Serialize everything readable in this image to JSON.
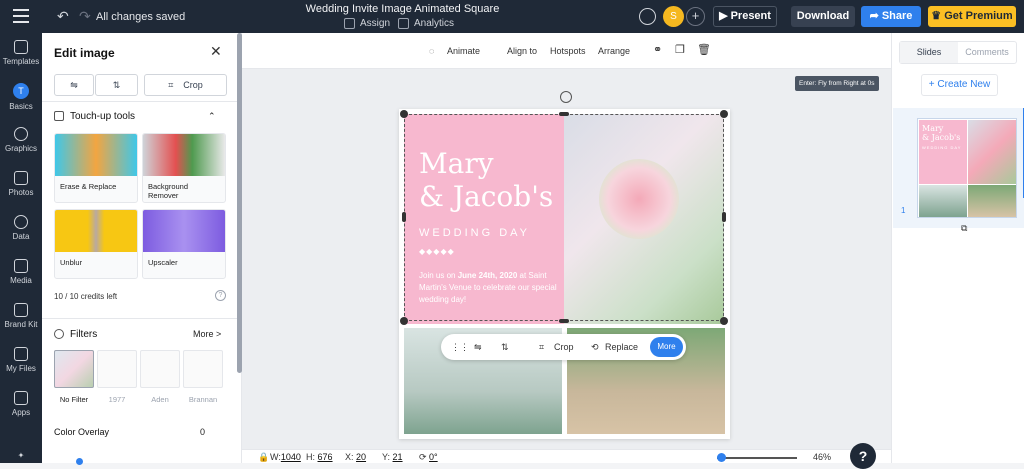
{
  "topbar": {
    "saved_status": "All changes saved",
    "doc_title": "Wedding Invite Image Animated Square",
    "assign_label": "Assign",
    "analytics_label": "Analytics",
    "avatar_initial": "S",
    "present_label": "Present",
    "download_label": "Download",
    "share_label": "Share",
    "premium_label": "Get Premium"
  },
  "rail": {
    "items": [
      {
        "label": "Templates",
        "icon": "grid-icon"
      },
      {
        "label": "Basics",
        "icon": "text-icon"
      },
      {
        "label": "Graphics",
        "icon": "shapes-icon"
      },
      {
        "label": "Photos",
        "icon": "photo-icon"
      },
      {
        "label": "Data",
        "icon": "chart-icon"
      },
      {
        "label": "Media",
        "icon": "media-icon"
      },
      {
        "label": "Brand Kit",
        "icon": "brand-icon"
      },
      {
        "label": "My Files",
        "icon": "folder-icon"
      },
      {
        "label": "Apps",
        "icon": "apps-icon"
      }
    ],
    "active_letter": "T"
  },
  "panel": {
    "title": "Edit image",
    "crop_label": "Crop",
    "touchup_title": "Touch-up tools",
    "tools": [
      {
        "label": "Erase & Replace"
      },
      {
        "label": "Background Remover"
      },
      {
        "label": "Unblur"
      },
      {
        "label": "Upscaler"
      }
    ],
    "credits": "10 / 10 credits left",
    "filters_title": "Filters",
    "filters_more": "More >",
    "filters": [
      "No Filter",
      "1977",
      "Aden",
      "Brannan"
    ],
    "color_overlay_label": "Color Overlay",
    "color_overlay_value": "0"
  },
  "ctoolbar": {
    "animate": "Animate",
    "align_to": "Align to",
    "hotspots": "Hotspots",
    "arrange": "Arrange"
  },
  "canvas": {
    "anim_tag": "Enter: Fly from Right at 0s",
    "name_line1": "Mary",
    "name_line2": "& Jacob's",
    "wedding_day": "WEDDING DAY",
    "dots": "◆◆◆◆◆",
    "invite_pre": "Join us on ",
    "invite_date": "June 24th, 2020",
    "invite_post": " at Saint Martin's Venue to celebrate our special wedding day!"
  },
  "floatbar": {
    "crop": "Crop",
    "replace": "Replace",
    "more": "More"
  },
  "status": {
    "w_label": "W:",
    "w_value": "1040",
    "h_label": "H:",
    "h_value": "676",
    "x_label": "X:",
    "x_value": "20",
    "y_label": "Y:",
    "y_value": "21",
    "rot_value": "0°",
    "zoom": "46%",
    "zoom_level": 0.46
  },
  "help_label": "?",
  "rpanel": {
    "tab_slides": "Slides",
    "tab_comments": "Comments",
    "create_new": "+ Create New",
    "slide_number": "1",
    "thumb_name1": "Mary",
    "thumb_name2": "& Jacob's",
    "thumb_wedding": "WEDDING DAY"
  },
  "colors": {
    "accent": "#2f80ed",
    "topbar": "#1f2937",
    "pink": "#f7b8cf",
    "premium": "#fbbf24"
  }
}
